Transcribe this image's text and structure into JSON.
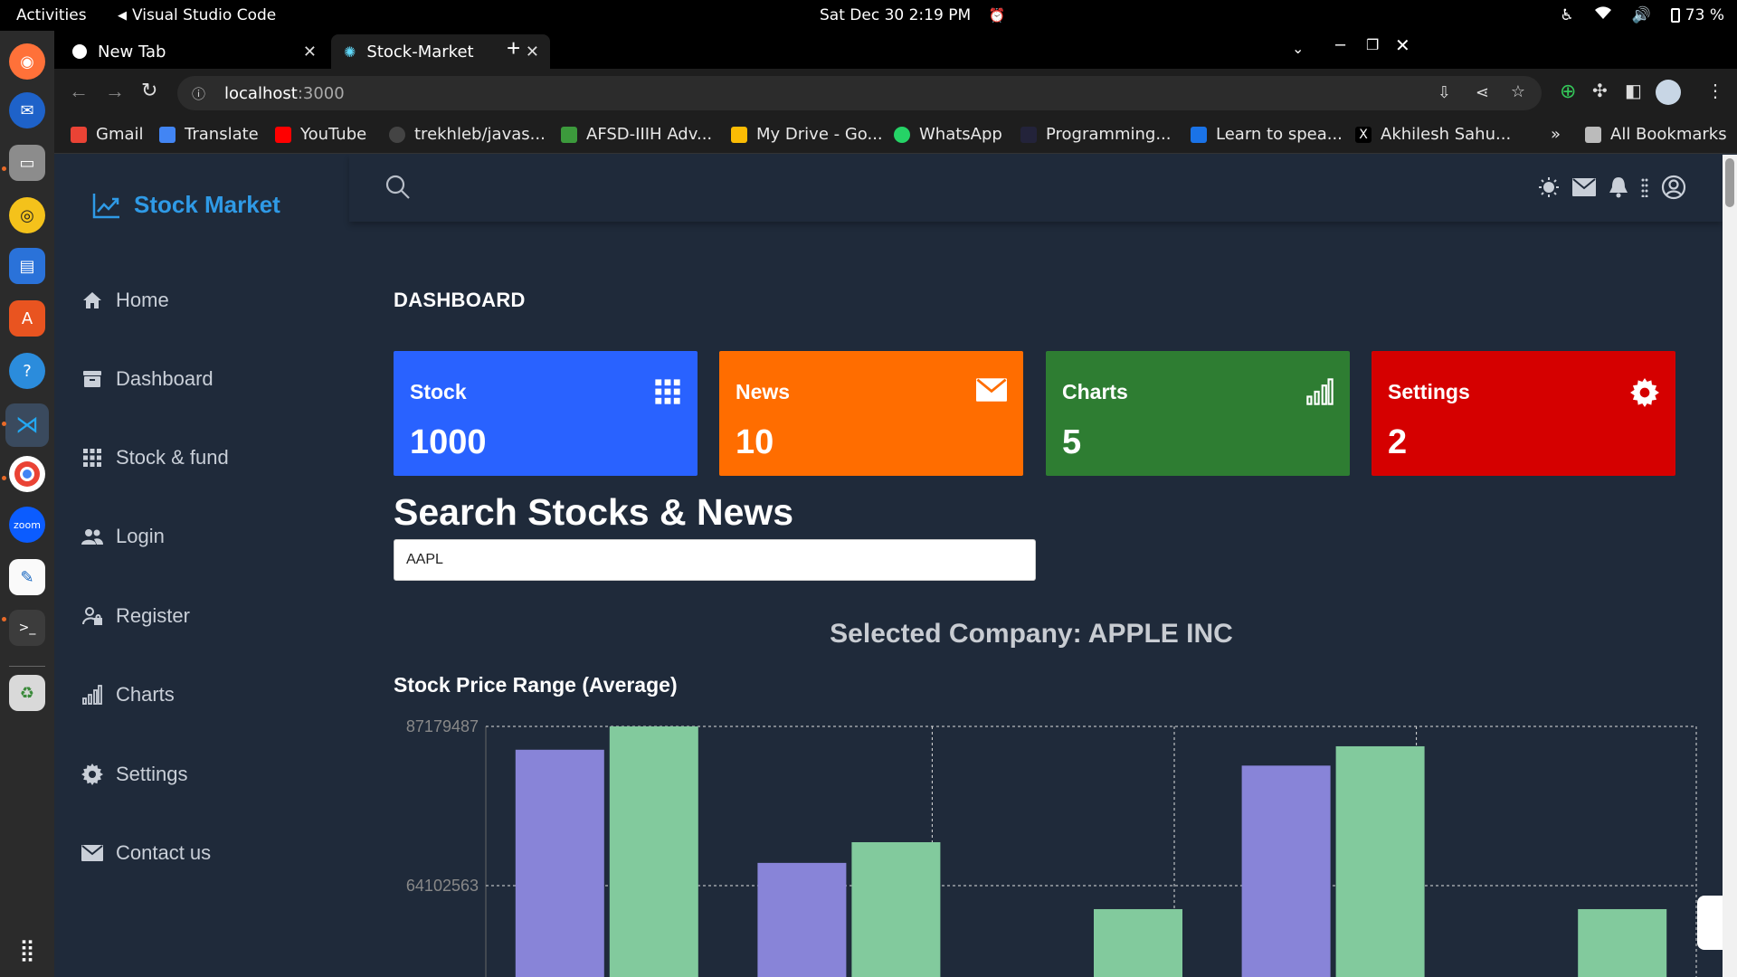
{
  "system": {
    "activities": "Activities",
    "app_name": "Visual Studio Code",
    "clock": "Sat Dec 30   2:19 PM",
    "battery": "73 %"
  },
  "browser": {
    "tabs": [
      {
        "label": "New Tab",
        "active": false
      },
      {
        "label": "Stock-Market",
        "active": true
      }
    ],
    "url_host": "localhost",
    "url_port": ":3000",
    "bookmarks": [
      "Gmail",
      "Translate",
      "YouTube",
      "trekhleb/javas...",
      "AFSD-IIIH Adv...",
      "My Drive - Go...",
      "WhatsApp",
      "Programming...",
      "Learn to spea...",
      "Akhilesh Sahu..."
    ],
    "bookmarks_overflow": "»",
    "all_bookmarks": "All Bookmarks"
  },
  "app": {
    "brand": "Stock Market",
    "nav": [
      {
        "label": "Home",
        "icon": "home-icon"
      },
      {
        "label": "Dashboard",
        "icon": "archive-icon"
      },
      {
        "label": "Stock & fund",
        "icon": "grid-icon"
      },
      {
        "label": "Login",
        "icon": "users-icon"
      },
      {
        "label": "Register",
        "icon": "user-lock-icon"
      },
      {
        "label": "Charts",
        "icon": "bar-chart-icon"
      },
      {
        "label": "Settings",
        "icon": "gear-icon"
      },
      {
        "label": "Contact us",
        "icon": "envelope-icon"
      }
    ],
    "page_title": "DASHBOARD",
    "cards": [
      {
        "label": "Stock",
        "value": "1000",
        "color": "#2962ff",
        "icon": "grid-icon"
      },
      {
        "label": "News",
        "value": "10",
        "color": "#ff6d00",
        "icon": "envelope-icon"
      },
      {
        "label": "Charts",
        "value": "5",
        "color": "#2e7d32",
        "icon": "bar-chart-icon"
      },
      {
        "label": "Settings",
        "value": "2",
        "color": "#d50000",
        "icon": "gear-icon"
      }
    ],
    "search_title": "Search Stocks & News",
    "search_value": "AAPL",
    "selected_company": "Selected Company: APPLE INC",
    "chart_title": "Stock Price Range (Average)"
  },
  "chart_data": {
    "type": "bar",
    "title": "Stock Price Range (Average)",
    "yticks": [
      "87179487",
      "64102563"
    ],
    "ylim": [
      35000000,
      87179487
    ],
    "grid": true,
    "categories": [
      "",
      "",
      "",
      "",
      ""
    ],
    "series": [
      {
        "color": "#8884d8",
        "values": [
          83800000,
          67400000,
          0,
          81500000,
          0
        ]
      },
      {
        "color": "#82ca9d",
        "values": [
          87179487,
          70400000,
          60700000,
          84300000,
          60700000
        ]
      }
    ]
  }
}
